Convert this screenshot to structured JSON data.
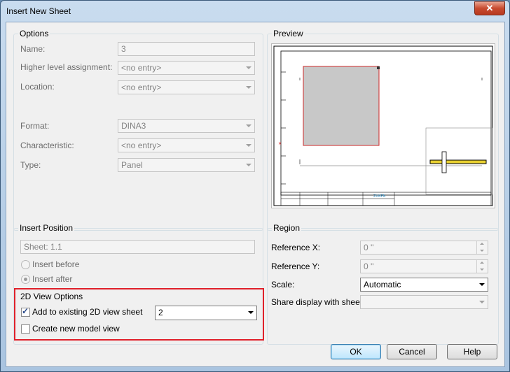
{
  "window": {
    "title": "Insert New Sheet",
    "close_glyph": "✕"
  },
  "options": {
    "label": "Options",
    "name_label": "Name:",
    "name_value": "3",
    "higher_label": "Higher level assignment:",
    "higher_value": "<no entry>",
    "location_label": "Location:",
    "location_value": "<no entry>",
    "format_label": "Format:",
    "format_value": "DINA3",
    "characteristic_label": "Characteristic:",
    "characteristic_value": "<no entry>",
    "type_label": "Type:",
    "type_value": "Panel"
  },
  "preview": {
    "label": "Preview",
    "logo_text": "ZUKEN"
  },
  "insert_position": {
    "label": "Insert Position",
    "sheet_value": "Sheet: 1.1",
    "before_label": "Insert before",
    "after_label": "Insert after"
  },
  "view2d": {
    "label": "2D View Options",
    "add_existing_label": "Add to existing 2D view sheet",
    "add_existing_value": "2",
    "create_model_label": "Create new model view"
  },
  "region": {
    "label": "Region",
    "refx_label": "Reference X:",
    "refx_value": "0 ''",
    "refy_label": "Reference Y:",
    "refy_value": "0 ''",
    "scale_label": "Scale:",
    "scale_value": "Automatic",
    "share_label": "Share display with sheet:",
    "share_value": ""
  },
  "buttons": {
    "ok": "OK",
    "cancel": "Cancel",
    "help": "Help"
  },
  "colors": {
    "highlight": "#e0202a",
    "preview_rect_border": "#cc2a2a",
    "preview_rect_fill": "#c8c8c8"
  }
}
